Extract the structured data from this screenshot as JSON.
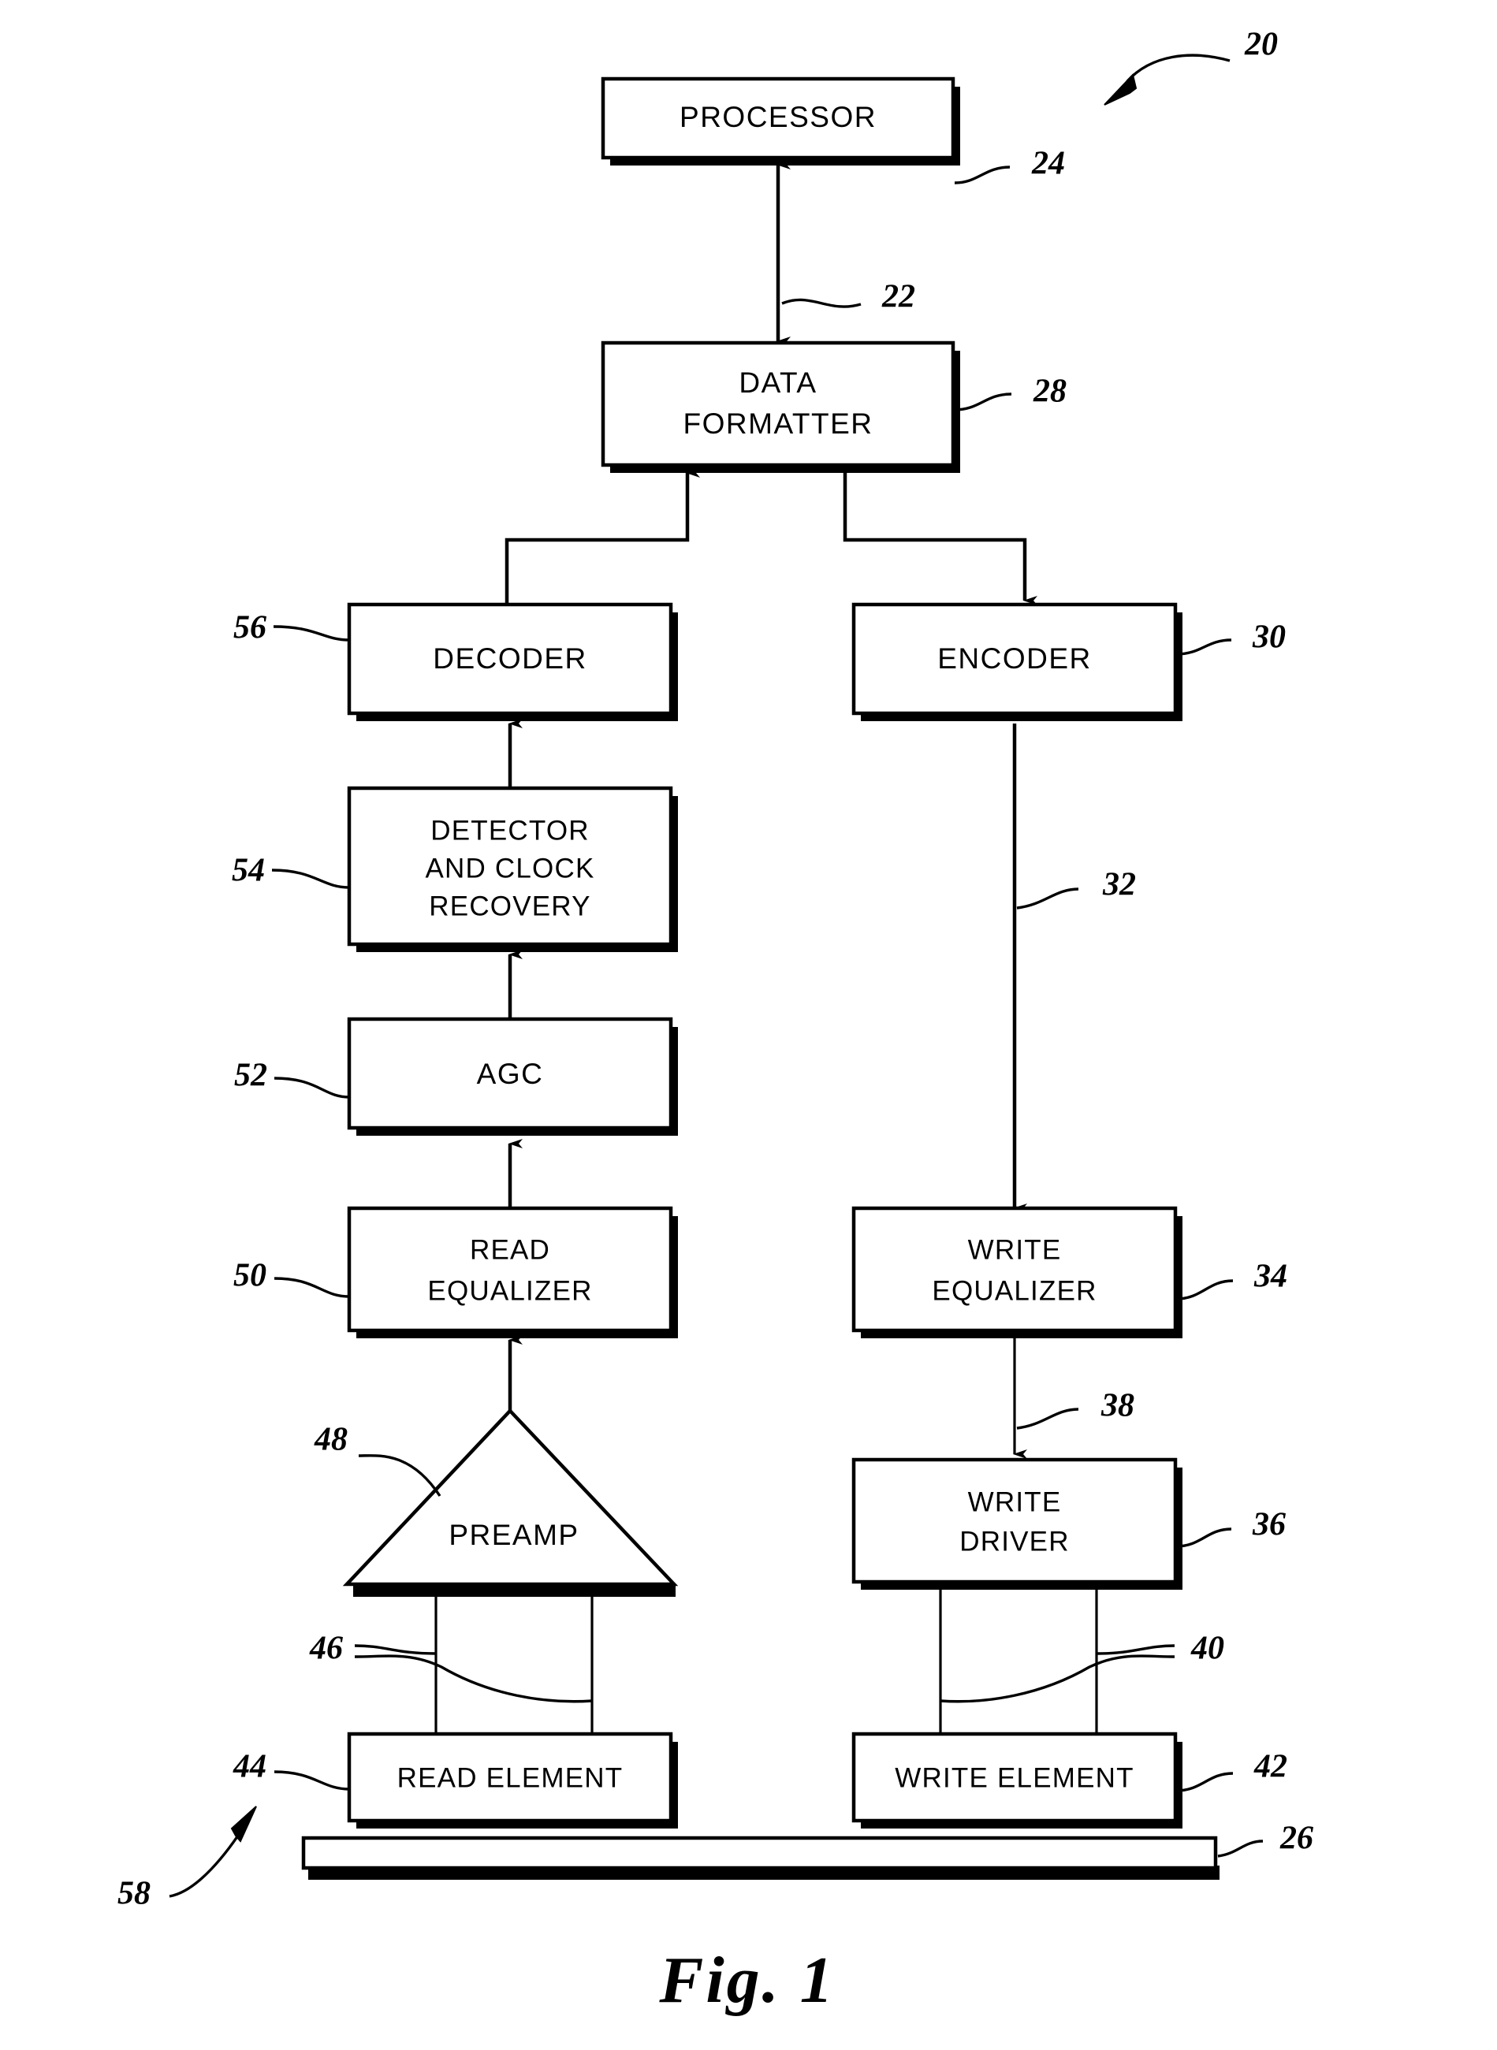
{
  "figure": {
    "caption": "Fig. 1",
    "system_ref": "20"
  },
  "blocks": [
    {
      "id": "processor",
      "label": "PROCESSOR",
      "lines": [
        "PROCESSOR"
      ],
      "ref": "24",
      "ref_side": "right"
    },
    {
      "id": "data-formatter",
      "label": "DATA FORMATTER",
      "lines": [
        "DATA",
        "FORMATTER"
      ],
      "ref": "28",
      "ref_side": "right"
    },
    {
      "id": "decoder",
      "label": "DECODER",
      "lines": [
        "DECODER"
      ],
      "ref": "56",
      "ref_side": "left"
    },
    {
      "id": "encoder",
      "label": "ENCODER",
      "lines": [
        "ENCODER"
      ],
      "ref": "30",
      "ref_side": "right"
    },
    {
      "id": "detector",
      "label": "DETECTOR AND CLOCK RECOVERY",
      "lines": [
        "DETECTOR",
        "AND CLOCK",
        "RECOVERY"
      ],
      "ref": "54",
      "ref_side": "left"
    },
    {
      "id": "agc",
      "label": "AGC",
      "lines": [
        "AGC"
      ],
      "ref": "52",
      "ref_side": "left"
    },
    {
      "id": "read-equalizer",
      "label": "READ EQUALIZER",
      "lines": [
        "READ",
        "EQUALIZER"
      ],
      "ref": "50",
      "ref_side": "left"
    },
    {
      "id": "write-equalizer",
      "label": "WRITE EQUALIZER",
      "lines": [
        "WRITE",
        "EQUALIZER"
      ],
      "ref": "34",
      "ref_side": "right"
    },
    {
      "id": "preamp",
      "label": "PREAMP",
      "lines": [
        "PREAMP"
      ],
      "ref": "48",
      "ref_side": "left"
    },
    {
      "id": "write-driver",
      "label": "WRITE DRIVER",
      "lines": [
        "WRITE",
        "DRIVER"
      ],
      "ref": "36",
      "ref_side": "right"
    },
    {
      "id": "read-element",
      "label": "READ ELEMENT",
      "lines": [
        "READ ELEMENT"
      ],
      "ref": "44",
      "ref_side": "left"
    },
    {
      "id": "write-element",
      "label": "WRITE ELEMENT",
      "lines": [
        "WRITE ELEMENT"
      ],
      "ref": "42",
      "ref_side": "right"
    },
    {
      "id": "media",
      "label": "",
      "lines": [],
      "ref": "26",
      "ref_side": "right"
    }
  ],
  "labels": {
    "processor": "PROCESSOR",
    "data_formatter_1": "DATA",
    "data_formatter_2": "FORMATTER",
    "decoder": "DECODER",
    "encoder": "ENCODER",
    "detector_1": "DETECTOR",
    "detector_2": "AND CLOCK",
    "detector_3": "RECOVERY",
    "agc": "AGC",
    "read_equalizer_1": "READ",
    "read_equalizer_2": "EQUALIZER",
    "write_equalizer_1": "WRITE",
    "write_equalizer_2": "EQUALIZER",
    "preamp": "PREAMP",
    "write_driver_1": "WRITE",
    "write_driver_2": "DRIVER",
    "read_element": "READ ELEMENT",
    "write_element": "WRITE ELEMENT"
  },
  "reference_numerals": {
    "system": "20",
    "processor_bus": "22",
    "processor": "24",
    "media": "26",
    "data_formatter": "28",
    "encoder": "30",
    "encoder_output": "32",
    "write_equalizer": "34",
    "write_driver": "36",
    "write_driver_input": "38",
    "write_leads": "40",
    "write_element": "42",
    "read_element": "44",
    "read_leads": "46",
    "preamp": "48",
    "read_equalizer": "50",
    "agc": "52",
    "detector": "54",
    "decoder": "56",
    "head_assembly": "58"
  },
  "colors": {
    "line": "#000000",
    "fill": "#ffffff",
    "shadow": "#000000"
  }
}
